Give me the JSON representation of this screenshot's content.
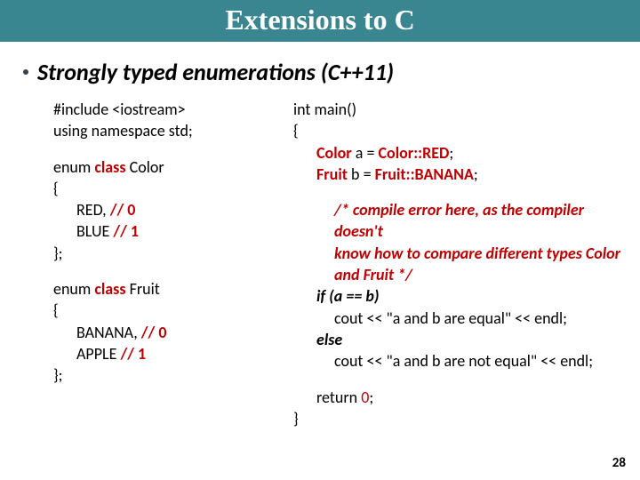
{
  "title": "Extensions to C",
  "subtitle": "Strongly typed enumerations (C++11)",
  "page_number": "28",
  "left": {
    "l1": "#include <iostream>",
    "l2": "using namespace std;",
    "enum1_pre": "enum ",
    "kw_class": "class",
    "enum1_name": " Color",
    "brace_open": "{",
    "c_red": "RED,   ",
    "cmt0": "// 0",
    "c_blue": "BLUE  ",
    "cmt1": "// 1",
    "brace_close": "};",
    "enum2_name": " Fruit",
    "c_banana": "BANANA,    ",
    "c_apple": "APPLE        "
  },
  "right": {
    "m1": "int main()",
    "m2": "{",
    "color_kw": "Color",
    "color_rest": "  a = ",
    "colorval": "Color::RED",
    "semicolon": ";",
    "fruit_kw": "Fruit",
    "fruit_rest": "    b = ",
    "fruitval": "Fruit::BANANA",
    "cmt_a": "/* compile error here",
    "cmt_b": ", as the compiler doesn't",
    "cmt_c": "know how to compare different types Color",
    "cmt_d": "and Fruit */",
    "if_line": "if (a == b)",
    "cout1": "cout << \"a and b are equal\" << endl;",
    "else_line": "else",
    "cout2": "cout << \"a and b are not equal\" << endl;",
    "ret": "return 0;",
    "close": "}"
  }
}
